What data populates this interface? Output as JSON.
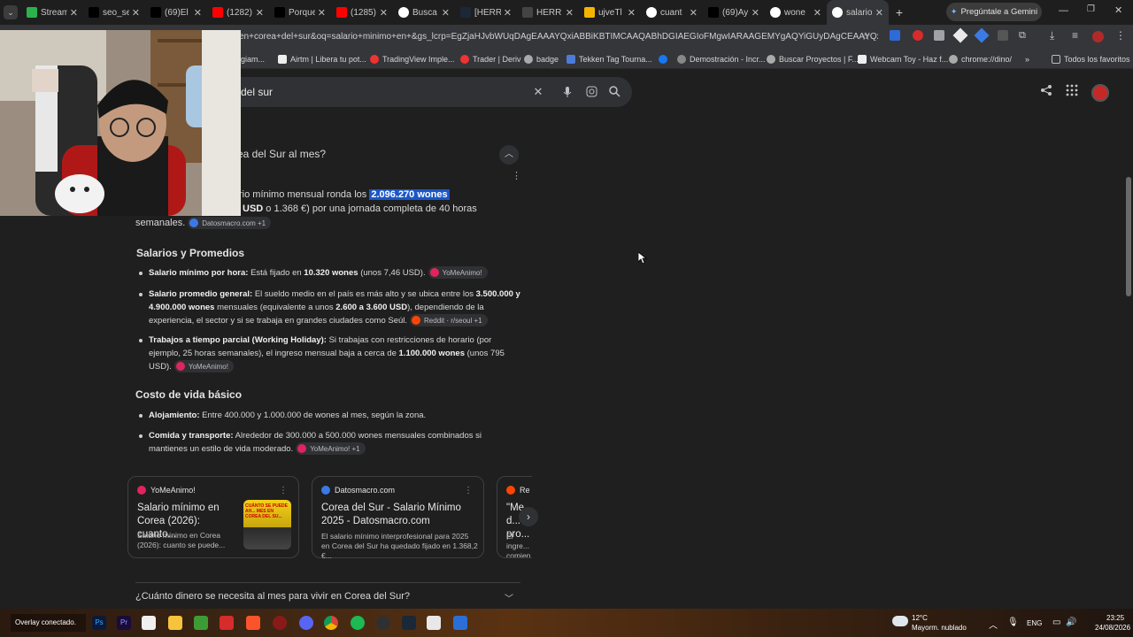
{
  "tabs": [
    {
      "title": "Stream",
      "icon": "green-square"
    },
    {
      "title": "seo_se",
      "icon": "tiktok"
    },
    {
      "title": "(69)El",
      "icon": "tiktok"
    },
    {
      "title": "(1282)",
      "icon": "youtube"
    },
    {
      "title": "Porque",
      "icon": "tiktok"
    },
    {
      "title": "(1285)",
      "icon": "youtube"
    },
    {
      "title": "Busca",
      "icon": "google"
    },
    {
      "title": "[HERR",
      "icon": "steam"
    },
    {
      "title": "HERR",
      "icon": "dots"
    },
    {
      "title": "ujveTl",
      "icon": "folder"
    },
    {
      "title": "cuant",
      "icon": "google"
    },
    {
      "title": "(69)Ay",
      "icon": "tiktok"
    },
    {
      "title": "wone",
      "icon": "google"
    },
    {
      "title": "salario",
      "icon": "google"
    }
  ],
  "gemini_button": "Pregúntale a Gemini",
  "address": "en+corea+del+sur&oq=salario+minimo+en+&gs_lcrp=EgZjaHJvbWUqDAgEAAAYQxiABBiKBTIMCAAQABhDGIAEGIoFMgwIARAAGEMYgAQYiGUyDAgCEAAYQxiABBiKB",
  "bookmarks": [
    "giam...",
    "Airtm | Libera tu pot...",
    "TradingView Imple...",
    "Trader | Deriv",
    "badge",
    "Tekken Tag Tourna...",
    "Demostración - Incr...",
    "Buscar Proyectos | F...",
    "Webcam Toy - Haz f...",
    "chrome://dino/",
    "Todos los favoritos"
  ],
  "search": {
    "query": "del sur"
  },
  "question_top": "ea del Sur al mes?",
  "intro": {
    "part1": "rio mínimo mensual ronda los",
    "highlight": "2.096.270 wones",
    "usd": "USD",
    "part2": "o 1.368 €) por una jornada completa de 40 horas",
    "part3": "semanales.",
    "chip": "Datosmacro.com +1"
  },
  "salarios": {
    "title": "Salarios y Promedios",
    "items": [
      {
        "label": "Salario mínimo por hora:",
        "t1": "Está fijado en",
        "b1": "10.320 wones",
        "t2": "(unos 7,46 USD).",
        "chip": "YoMeAnimo!"
      },
      {
        "label": "Salario promedio general:",
        "t1": "El sueldo medio en el país es más alto y se ubica entre los",
        "b1": "3.500.000 y 4.900.000 wones",
        "t2": "mensuales (equivalente a unos",
        "b2": "2.600 a 3.600 USD",
        "t3": "), dependiendo de la experiencia, el sector y si se trabaja en grandes ciudades como Seúl.",
        "chip": "Reddit · r/seoul +1"
      },
      {
        "label": "Trabajos a tiempo parcial (Working Holiday):",
        "t1": "Si trabajas con restricciones de horario (por ejemplo, 25 horas semanales), el ingreso mensual baja a cerca de",
        "b1": "1.100.000 wones",
        "t2": "(unos 795 USD).",
        "chip": "YoMeAnimo!"
      }
    ]
  },
  "costo": {
    "title": "Costo de vida básico",
    "items": [
      {
        "label": "Alojamiento:",
        "t1": "Entre 400.000 y 1.000.000 de wones al mes, según la zona.",
        "chip": ""
      },
      {
        "label": "Comida y transporte:",
        "t1": "Alrededor de 300.000 a 500.000 wones mensuales combinados si mantienes un estilo de vida moderado.",
        "chip": "YoMeAnimo! +1"
      }
    ]
  },
  "cards": [
    {
      "source": "YoMeAnimo!",
      "title": "Salario mínimo en Corea (2026): cuanto...",
      "snippet": "Salario mínimo en Corea (2026): cuanto se puede...",
      "thumb_text": "CUÁNTO SE PUEDE AH... MES EN COREA DEL SU..."
    },
    {
      "source": "Datosmacro.com",
      "title": "Corea del Sur - Salario Mínimo 2025 - Datosmacro.com",
      "snippet": "El salario mínimo interprofesional para 2025 en Corea del Sur ha quedado fijado en 1.368,2 €..."
    },
    {
      "source": "Re",
      "title": "\"Me d... pro...",
      "snippet": "El ingre... comien..."
    }
  ],
  "next_question": "¿Cuánto dinero se necesita al mes para vivir en Corea del Sur?",
  "taskbar": {
    "overlay_text": "Overlay conectado.",
    "weather_temp": "12°C",
    "weather_desc": "Mayorm. nublado",
    "lang": "ENG",
    "time": "23:25",
    "date": "24/08/2026"
  },
  "colors": {
    "accent_highlight": "#1a56c8",
    "page_bg": "#1f1f1f",
    "search_bg": "#303134"
  }
}
